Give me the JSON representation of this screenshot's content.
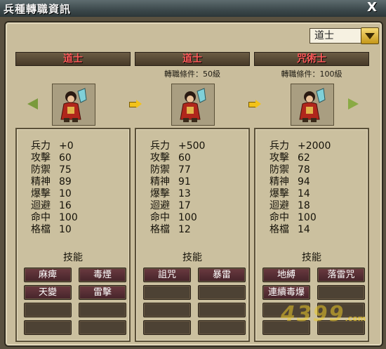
{
  "window": {
    "title": "兵種轉職資訊",
    "close_label": "X"
  },
  "dropdown": {
    "selected": "道士"
  },
  "stat_labels": [
    "兵力",
    "攻擊",
    "防禦",
    "精神",
    "爆擊",
    "迴避",
    "命中",
    "格檔"
  ],
  "skills_heading": "技能",
  "classes": [
    {
      "name": "道士",
      "requirement": "",
      "stats": [
        "+0",
        "60",
        "75",
        "89",
        "10",
        "16",
        "100",
        "10"
      ],
      "skills": [
        "麻痺",
        "毒煙",
        "天變",
        "雷擊",
        "",
        "",
        "",
        ""
      ]
    },
    {
      "name": "道士",
      "requirement": "轉職條件：50級",
      "stats": [
        "+500",
        "60",
        "77",
        "91",
        "13",
        "17",
        "100",
        "12"
      ],
      "skills": [
        "詛咒",
        "暴雷",
        "",
        "",
        "",
        "",
        "",
        ""
      ]
    },
    {
      "name": "咒術士",
      "requirement": "轉職條件：100級",
      "stats": [
        "+2000",
        "62",
        "78",
        "94",
        "14",
        "18",
        "100",
        "14"
      ],
      "skills": [
        "地縛",
        "落雷咒",
        "連續毒爆",
        "",
        "",
        "",
        "",
        ""
      ]
    }
  ],
  "watermark": {
    "logo": "4399",
    "suffix": ".com"
  },
  "icons": {
    "close": "close-icon",
    "dropdown": "chevron-down-icon",
    "prev": "arrow-left-icon",
    "next": "arrow-right-icon",
    "progress": "arrow-right-small-icon"
  },
  "colors": {
    "class_name": "#ff5a5a",
    "panel": "#c9bd9c",
    "skill_filled": "#5a3036"
  }
}
